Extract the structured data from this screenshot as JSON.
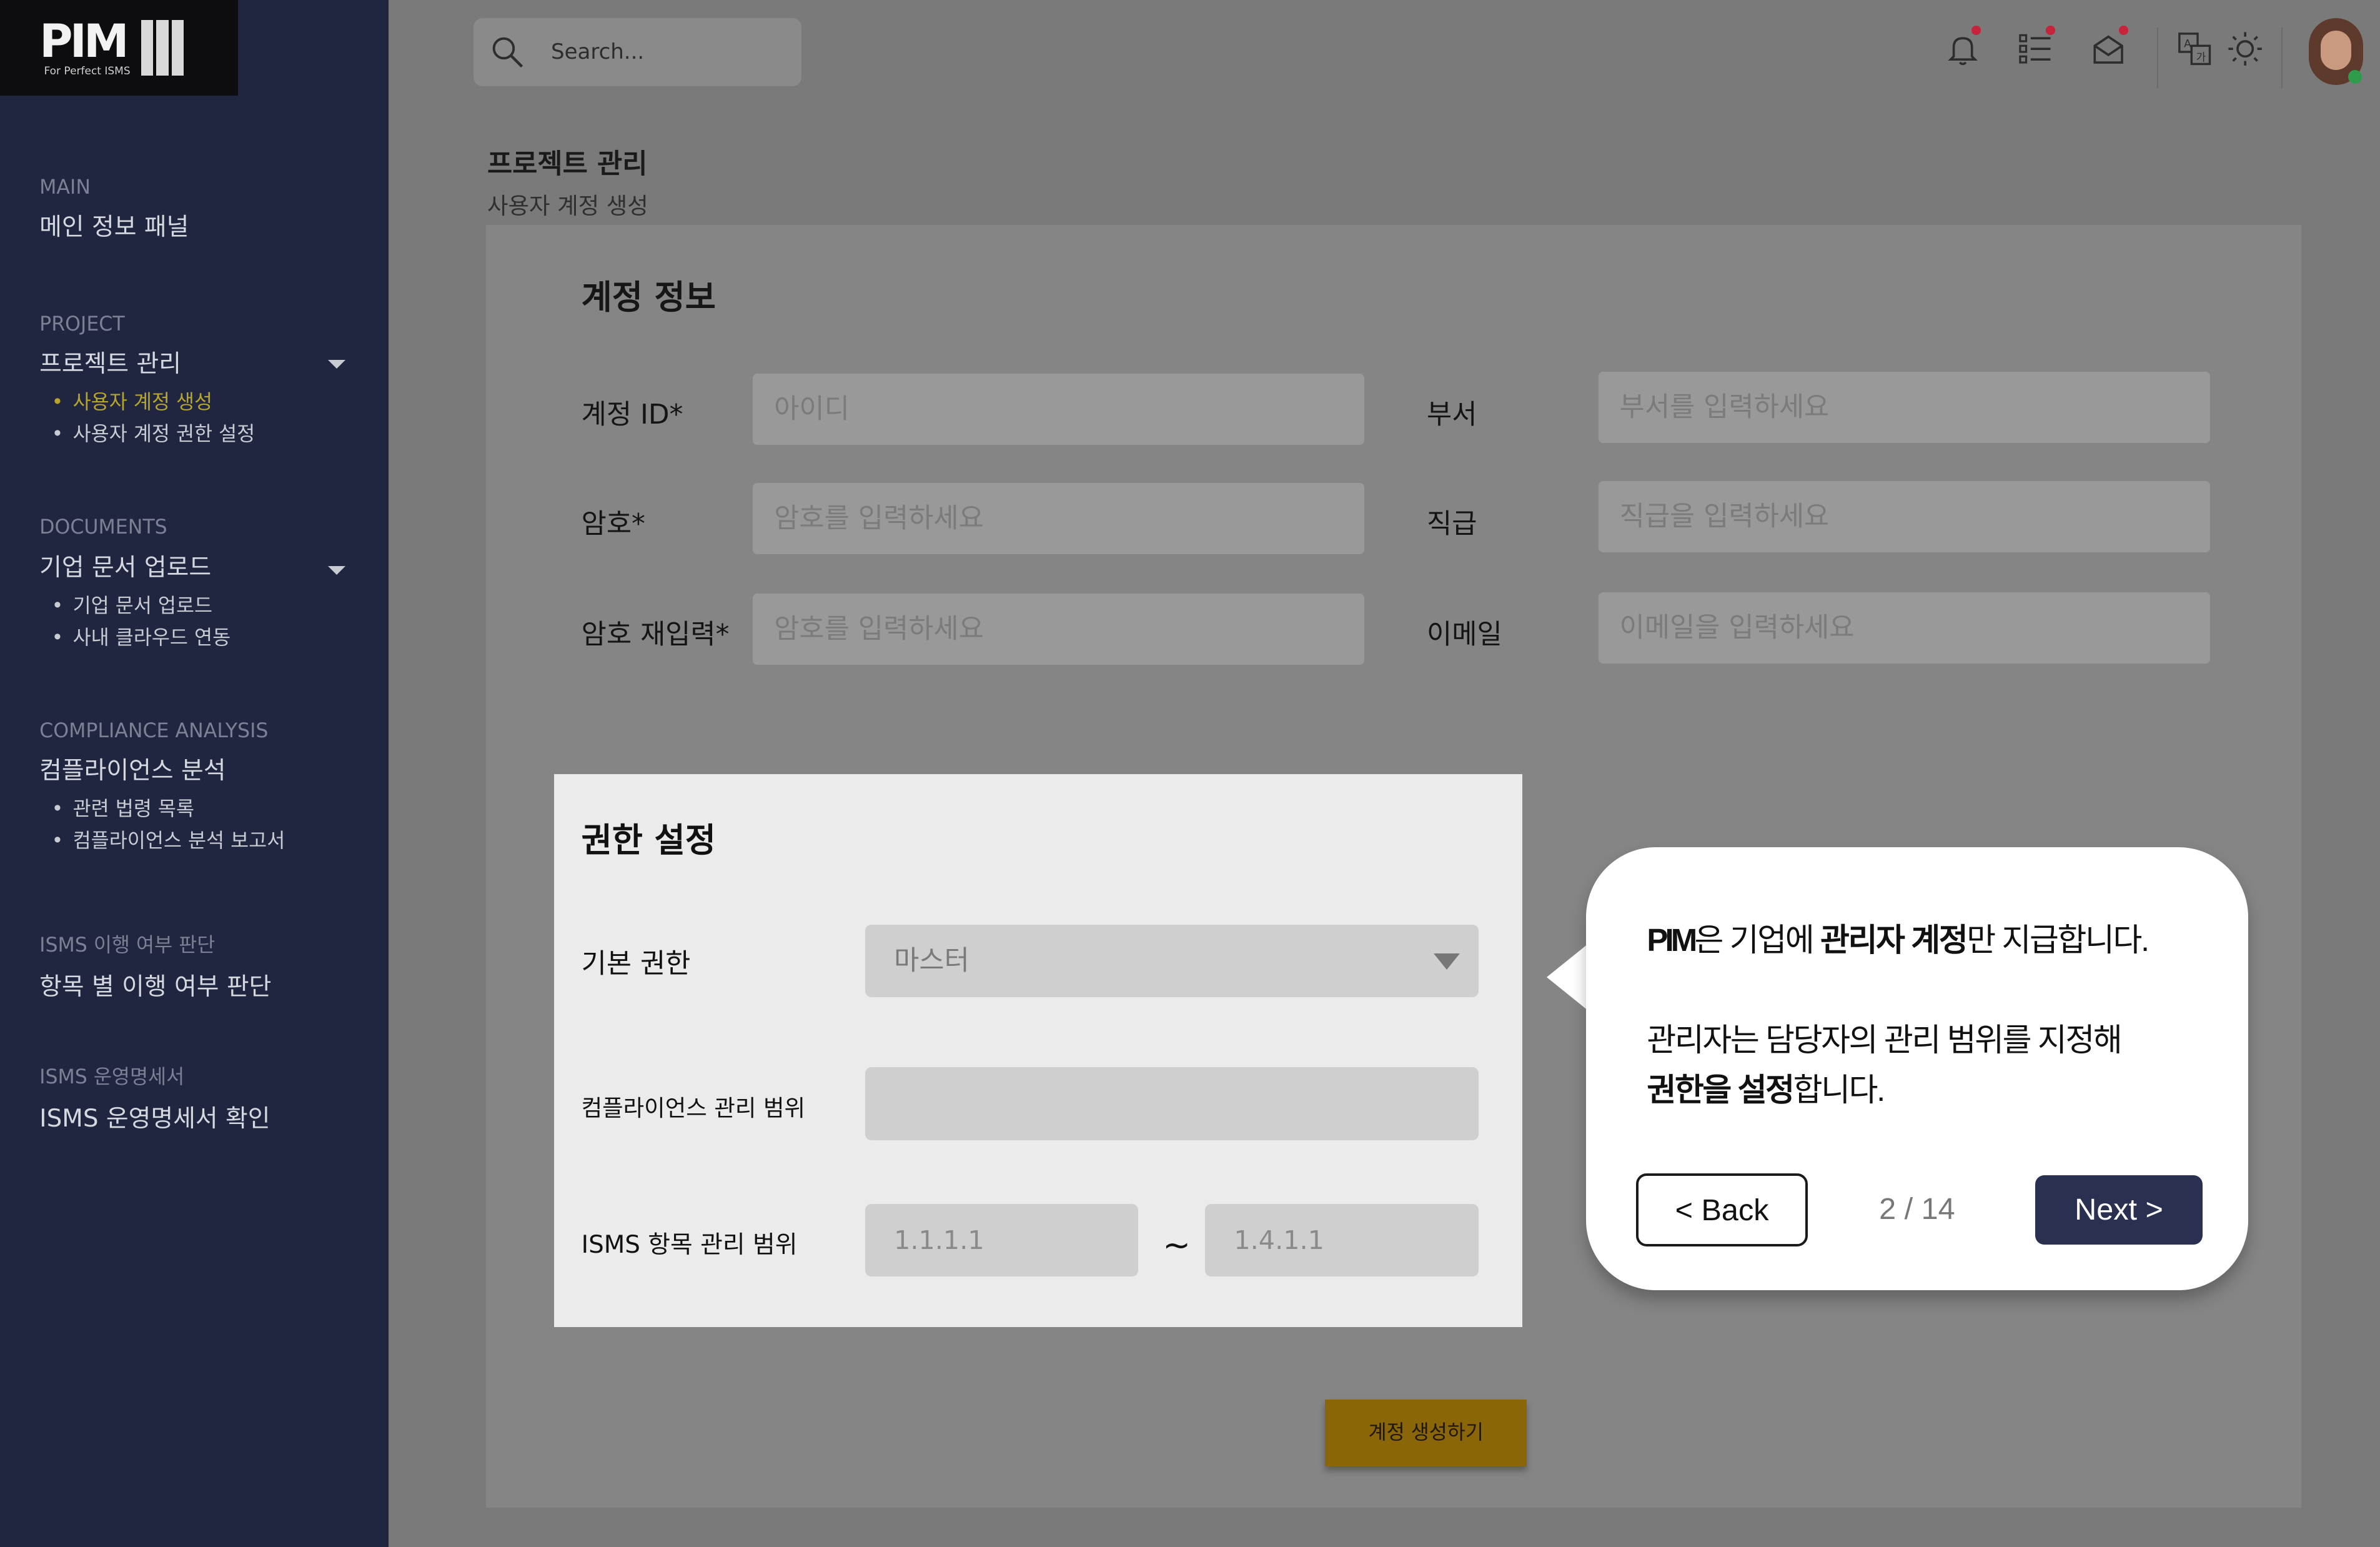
{
  "logo": {
    "text": "PIM",
    "tagline": "For Perfect ISMS"
  },
  "sidebar": {
    "sections": [
      {
        "label": "MAIN",
        "title": "메인 정보 패널",
        "items": []
      },
      {
        "label": "PROJECT",
        "title": "프로젝트 관리",
        "items": [
          "사용자 계정 생성",
          "사용자 계정 권한 설정"
        ]
      },
      {
        "label": "DOCUMENTS",
        "title": "기업 문서 업로드",
        "items": [
          "기업 문서 업로드",
          "사내 클라우드 연동"
        ]
      },
      {
        "label": "COMPLIANCE ANALYSIS",
        "title": "컴플라이언스 분석",
        "items": [
          "관련 법령 목록",
          "컴플라이언스 분석 보고서"
        ]
      },
      {
        "label": "ISMS 이행 여부 판단",
        "title": "항목 별 이행 여부 판단",
        "items": []
      },
      {
        "label": "ISMS 운영명세서",
        "title": "ISMS 운영명세서 확인",
        "items": []
      }
    ]
  },
  "search": {
    "placeholder": "Search..."
  },
  "toolbar_icons": [
    "bell-icon",
    "list-icon",
    "mail-icon",
    "translate-icon",
    "sun-icon"
  ],
  "page": {
    "title": "프로젝트 관리",
    "subtitle": "사용자 계정 생성"
  },
  "account_form": {
    "title": "계정 정보",
    "fields": [
      {
        "label": "계정 ID*",
        "placeholder": "아이디"
      },
      {
        "label": "부서",
        "placeholder": "부서를 입력하세요"
      },
      {
        "label": "암호*",
        "placeholder": "암호를 입력하세요"
      },
      {
        "label": "직급",
        "placeholder": "직급을 입력하세요"
      },
      {
        "label": "암호 재입력*",
        "placeholder": "암호를 입력하세요"
      },
      {
        "label": "이메일",
        "placeholder": "이메일을 입력하세요"
      }
    ],
    "submit_label": "계정 생성하기"
  },
  "permission_modal": {
    "title": "권한 설정",
    "basic_label": "기본 권한",
    "basic_value": "마스터",
    "compliance_label": "컴플라이언스 관리 범위",
    "compliance_value": "",
    "isms_label": "ISMS 항목 관리 범위",
    "isms_from": "1.1.1.1",
    "isms_separator": "~",
    "isms_to": "1.4.1.1"
  },
  "tour": {
    "line1_brand": "PIM",
    "line1_a": "은 기업에 ",
    "line1_b": "관리자 계정",
    "line1_c": "만 지급합니다.",
    "line2": "관리자는 담당자의 관리 범위를 지정해",
    "line3_b": "권한을 설정",
    "line3_c": "합니다.",
    "back_label": "< Back",
    "pager": "2 / 14",
    "next_label": "Next >"
  },
  "colors": {
    "sidebar": "#202540",
    "accent": "#b7a52a",
    "next_button": "#2a3150",
    "submit_button": "#8a6608",
    "notification_dot": "#c7233b"
  }
}
